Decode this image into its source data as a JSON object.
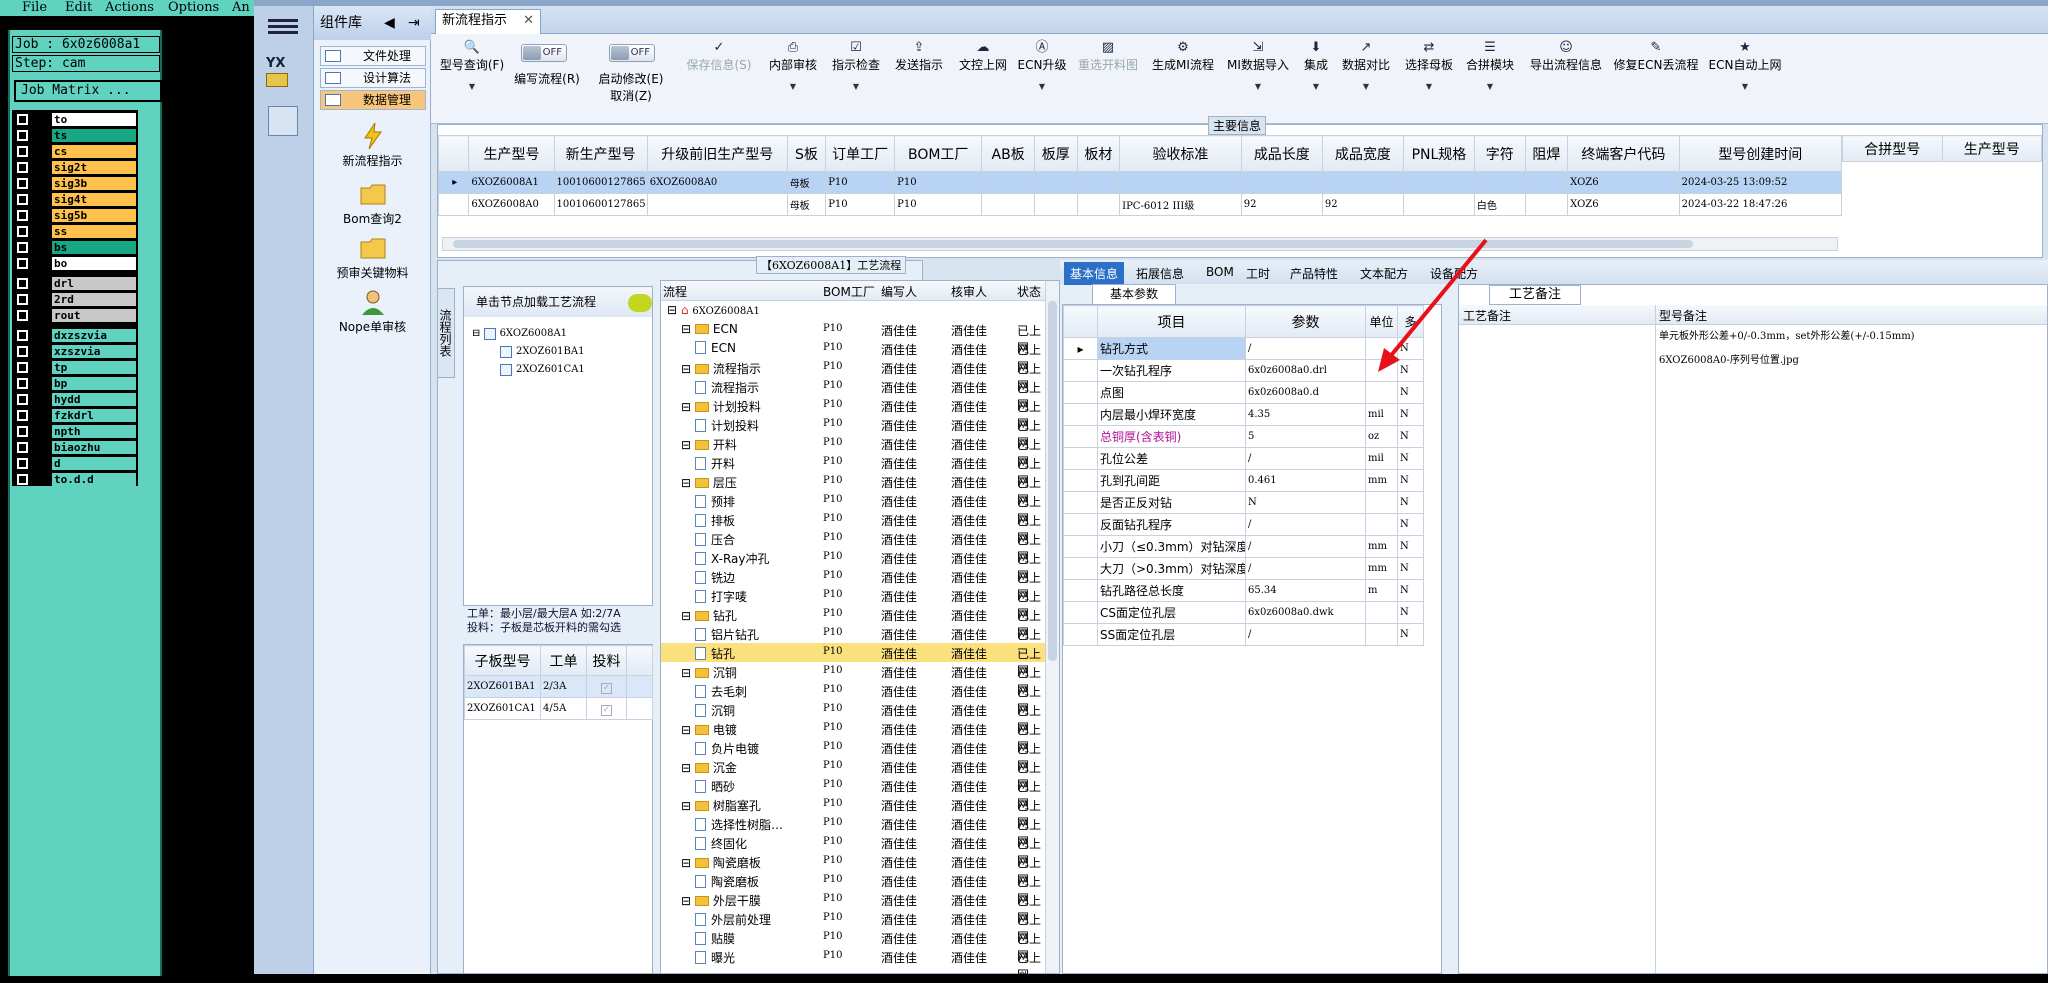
{
  "menubar": {
    "items": [
      "File",
      "Edit",
      "Actions",
      "Options",
      "An"
    ]
  },
  "genesis": {
    "job_line": "Job : 6x0z6008a1",
    "step_line": "Step: cam",
    "job_matrix": "Job Matrix ...",
    "layers": [
      {
        "name": "to",
        "color": "#ffffff"
      },
      {
        "name": "ts",
        "color": "#16a783"
      },
      {
        "name": "cs",
        "color": "#ffc34d"
      },
      {
        "name": "sig2t",
        "color": "#ffc34d"
      },
      {
        "name": "sig3b",
        "color": "#ffc34d"
      },
      {
        "name": "sig4t",
        "color": "#ffc34d"
      },
      {
        "name": "sig5b",
        "color": "#ffc34d"
      },
      {
        "name": "ss",
        "color": "#ffc34d"
      },
      {
        "name": "bs",
        "color": "#16a783"
      },
      {
        "name": "bo",
        "color": "#ffffff"
      },
      {
        "name": "drl",
        "color": "#c8c8c8"
      },
      {
        "name": "2rd",
        "color": "#c8c8c8"
      },
      {
        "name": "rout",
        "color": "#c8c8c8"
      },
      {
        "name": "dxzszvia",
        "color": "#5fd3c0"
      },
      {
        "name": "xzszvia",
        "color": "#5fd3c0"
      },
      {
        "name": "tp",
        "color": "#5fd3c0"
      },
      {
        "name": "bp",
        "color": "#5fd3c0"
      },
      {
        "name": "hydd",
        "color": "#5fd3c0"
      },
      {
        "name": "fzkdrl",
        "color": "#5fd3c0"
      },
      {
        "name": "npth",
        "color": "#5fd3c0"
      },
      {
        "name": "biaozhu",
        "color": "#5fd3c0"
      },
      {
        "name": "d",
        "color": "#5fd3c0"
      },
      {
        "name": "to.d.d",
        "color": "#5fd3c0"
      }
    ]
  },
  "complib": {
    "title": "组件库",
    "items": [
      "文件处理",
      "设计算法",
      "数据管理"
    ],
    "big_items": [
      "新流程指示",
      "Bom查询2",
      "预审关键物料",
      "Nope单审核"
    ]
  },
  "tabs": {
    "active": "新流程指示"
  },
  "toolbar": {
    "buttons": [
      "型号查询(F)",
      "编写流程(R)",
      "启动修改(E)",
      "取消(Z)",
      "保存信息(S)",
      "内部审核",
      "指示检查",
      "发送指示",
      "文控上网",
      "ECN升级",
      "重选开料图",
      "生成MI流程",
      "MI数据导入",
      "集成",
      "数据对比",
      "选择母板",
      "合拼模块",
      "导出流程信息",
      "修复ECN丢流程",
      "ECN自动上网"
    ],
    "toggle_label": "OFF"
  },
  "main_info": {
    "legend": "主要信息",
    "columns": [
      "生产型号",
      "新生产型号",
      "升级前旧生产型号",
      "S板",
      "订单工厂",
      "BOM工厂",
      "AB板",
      "板厚",
      "板材",
      "验收标准",
      "成品长度",
      "成品宽度",
      "PNL规格",
      "字符",
      "阻焊",
      "终端客户代码",
      "型号创建时间"
    ],
    "rows": [
      [
        "6XOZ6008A1",
        "10010600127865",
        "6XOZ6008A0",
        "母板",
        "P10",
        "P10",
        "",
        "",
        "",
        "",
        "",
        "",
        "",
        "",
        "",
        "XOZ6",
        "2024-03-25 13:09:52"
      ],
      [
        "6XOZ6008A0",
        "10010600127865",
        "",
        "母板",
        "P10",
        "P10",
        "",
        "",
        "",
        "IPC-6012 III级",
        "92",
        "92",
        "",
        "白色",
        "",
        "XOZ6",
        "2024-03-22 18:47:26"
      ]
    ],
    "merge_columns": [
      "合拼型号",
      "生产型号"
    ]
  },
  "process": {
    "legend": "【6XOZ6008A1】工艺流程",
    "side_tab": "流程列表",
    "tree_hint": "单击节点加载工艺流程",
    "tree": [
      "6XOZ6008A1",
      "2XOZ601BA1",
      "2XOZ601CA1"
    ],
    "info_line1": "工单：最小层/最大层A 如:2/7A",
    "info_line2": "投料：子板是芯板开料的需勾选",
    "sub_columns": [
      "子板型号",
      "工单",
      "投料"
    ],
    "sub_rows": [
      [
        "2XOZ601BA1",
        "2/3A"
      ],
      [
        "2XOZ601CA1",
        "4/5A"
      ]
    ]
  },
  "flow": {
    "columns": [
      "流程",
      "BOM工厂",
      "编写人",
      "核审人",
      "状态"
    ],
    "root": "6XOZ6008A1",
    "rows": [
      {
        "name": "ECN",
        "folder": true,
        "f": "P10",
        "w": "酒佳佳",
        "r": "酒佳佳",
        "s": "已上网"
      },
      {
        "name": "ECN",
        "folder": false,
        "f": "P10",
        "w": "酒佳佳",
        "r": "酒佳佳",
        "s": "已上网"
      },
      {
        "name": "流程指示",
        "folder": true,
        "f": "P10",
        "w": "酒佳佳",
        "r": "酒佳佳",
        "s": "已上网"
      },
      {
        "name": "流程指示",
        "folder": false,
        "f": "P10",
        "w": "酒佳佳",
        "r": "酒佳佳",
        "s": "已上网"
      },
      {
        "name": "计划投料",
        "folder": true,
        "f": "P10",
        "w": "酒佳佳",
        "r": "酒佳佳",
        "s": "已上网"
      },
      {
        "name": "计划投料",
        "folder": false,
        "f": "P10",
        "w": "酒佳佳",
        "r": "酒佳佳",
        "s": "已上网"
      },
      {
        "name": "开料",
        "folder": true,
        "f": "P10",
        "w": "酒佳佳",
        "r": "酒佳佳",
        "s": "已上网"
      },
      {
        "name": "开料",
        "folder": false,
        "f": "P10",
        "w": "酒佳佳",
        "r": "酒佳佳",
        "s": "已上网"
      },
      {
        "name": "层压",
        "folder": true,
        "f": "P10",
        "w": "酒佳佳",
        "r": "酒佳佳",
        "s": "已上网"
      },
      {
        "name": "预排",
        "folder": false,
        "f": "P10",
        "w": "酒佳佳",
        "r": "酒佳佳",
        "s": "已上网"
      },
      {
        "name": "排板",
        "folder": false,
        "f": "P10",
        "w": "酒佳佳",
        "r": "酒佳佳",
        "s": "已上网"
      },
      {
        "name": "压合",
        "folder": false,
        "f": "P10",
        "w": "酒佳佳",
        "r": "酒佳佳",
        "s": "已上网"
      },
      {
        "name": "X-Ray冲孔",
        "folder": false,
        "f": "P10",
        "w": "酒佳佳",
        "r": "酒佳佳",
        "s": "已上网"
      },
      {
        "name": "铣边",
        "folder": false,
        "f": "P10",
        "w": "酒佳佳",
        "r": "酒佳佳",
        "s": "已上网"
      },
      {
        "name": "打字唛",
        "folder": false,
        "f": "P10",
        "w": "酒佳佳",
        "r": "酒佳佳",
        "s": "已上网"
      },
      {
        "name": "钻孔",
        "folder": true,
        "f": "P10",
        "w": "酒佳佳",
        "r": "酒佳佳",
        "s": "已上网"
      },
      {
        "name": "铝片钻孔",
        "folder": false,
        "f": "P10",
        "w": "酒佳佳",
        "r": "酒佳佳",
        "s": "已上网"
      },
      {
        "name": "钻孔",
        "folder": false,
        "f": "P10",
        "w": "酒佳佳",
        "r": "酒佳佳",
        "s": "已上网",
        "selected": true
      },
      {
        "name": "沉铜",
        "folder": true,
        "f": "P10",
        "w": "酒佳佳",
        "r": "酒佳佳",
        "s": "已上网"
      },
      {
        "name": "去毛刺",
        "folder": false,
        "f": "P10",
        "w": "酒佳佳",
        "r": "酒佳佳",
        "s": "已上网"
      },
      {
        "name": "沉铜",
        "folder": false,
        "f": "P10",
        "w": "酒佳佳",
        "r": "酒佳佳",
        "s": "已上网"
      },
      {
        "name": "电镀",
        "folder": true,
        "f": "P10",
        "w": "酒佳佳",
        "r": "酒佳佳",
        "s": "已上网"
      },
      {
        "name": "负片电镀",
        "folder": false,
        "f": "P10",
        "w": "酒佳佳",
        "r": "酒佳佳",
        "s": "已上网"
      },
      {
        "name": "沉金",
        "folder": true,
        "f": "P10",
        "w": "酒佳佳",
        "r": "酒佳佳",
        "s": "已上网"
      },
      {
        "name": "晒砂",
        "folder": false,
        "f": "P10",
        "w": "酒佳佳",
        "r": "酒佳佳",
        "s": "已上网"
      },
      {
        "name": "树脂塞孔",
        "folder": true,
        "f": "P10",
        "w": "酒佳佳",
        "r": "酒佳佳",
        "s": "已上网"
      },
      {
        "name": "选择性树脂…",
        "folder": false,
        "f": "P10",
        "w": "酒佳佳",
        "r": "酒佳佳",
        "s": "已上网"
      },
      {
        "name": "终固化",
        "folder": false,
        "f": "P10",
        "w": "酒佳佳",
        "r": "酒佳佳",
        "s": "已上网"
      },
      {
        "name": "陶瓷磨板",
        "folder": true,
        "f": "P10",
        "w": "酒佳佳",
        "r": "酒佳佳",
        "s": "已上网"
      },
      {
        "name": "陶瓷磨板",
        "folder": false,
        "f": "P10",
        "w": "酒佳佳",
        "r": "酒佳佳",
        "s": "已上网"
      },
      {
        "name": "外层干膜",
        "folder": true,
        "f": "P10",
        "w": "酒佳佳",
        "r": "酒佳佳",
        "s": "已上网"
      },
      {
        "name": "外层前处理",
        "folder": false,
        "f": "P10",
        "w": "酒佳佳",
        "r": "酒佳佳",
        "s": "已上网"
      },
      {
        "name": "贴膜",
        "folder": false,
        "f": "P10",
        "w": "酒佳佳",
        "r": "酒佳佳",
        "s": "已上网"
      },
      {
        "name": "曝光",
        "folder": false,
        "f": "P10",
        "w": "酒佳佳",
        "r": "酒佳佳",
        "s": "已上网"
      }
    ]
  },
  "detail": {
    "tabs": [
      "基本信息",
      "拓展信息",
      "BOM",
      "工时",
      "产品特性",
      "文本配方",
      "设备配方"
    ],
    "subtab": "基本参数",
    "param_columns": [
      "项目",
      "参数",
      "单位",
      "多"
    ],
    "params": [
      [
        "钻孔方式",
        "/",
        "",
        "N"
      ],
      [
        "一次钻孔程序",
        "6x0z6008a0.drl",
        "",
        "N"
      ],
      [
        "点图",
        "6x0z6008a0.d",
        "",
        "N"
      ],
      [
        "内层最小焊环宽度",
        "4.35",
        "mil",
        "N"
      ],
      [
        "总铜厚(含表铜)",
        "5",
        "oz",
        "N"
      ],
      [
        "孔位公差",
        "/",
        "mil",
        "N"
      ],
      [
        "孔到孔间距",
        "0.461",
        "mm",
        "N"
      ],
      [
        "是否正反对钻",
        "N",
        "",
        "N"
      ],
      [
        "反面钻孔程序",
        "/",
        "",
        "N"
      ],
      [
        "小刀（≤0.3mm）对钻深度",
        "/",
        "mm",
        "N"
      ],
      [
        "大刀（>0.3mm）对钻深度",
        "/",
        "mm",
        "N"
      ],
      [
        "钻孔路径总长度",
        "65.34",
        "m",
        "N"
      ],
      [
        "CS面定位孔层",
        "6x0z6008a0.dwk",
        "",
        "N"
      ],
      [
        "SS面定位孔层",
        "/",
        "",
        "N"
      ]
    ],
    "remark_tab": "工艺备注",
    "remark_columns": [
      "工艺备注",
      "型号备注"
    ],
    "remarks": [
      "单元板外形公差+0/-0.3mm，set外形公差(+/-0.15mm)",
      "6XOZ6008A0-序列号位置.jpg"
    ]
  }
}
